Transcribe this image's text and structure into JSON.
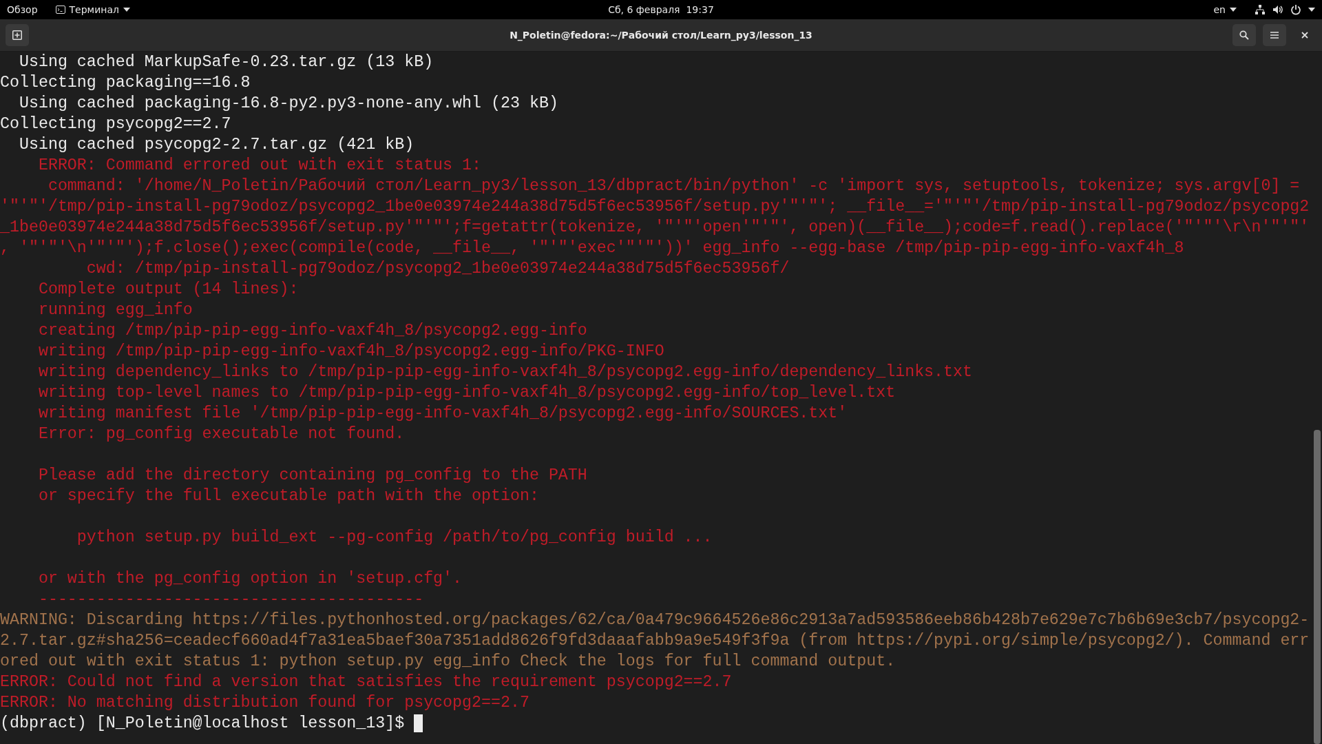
{
  "top_bar": {
    "activities": "Обзор",
    "app_menu": "Терминал",
    "clock": "Сб, 6 февраля  19:37",
    "keyboard_layout": "en"
  },
  "window": {
    "title": "N_Poletin@fedora:~/Рабочий стол/Learn_py3/lesson_13"
  },
  "terminal": {
    "lines": [
      {
        "kind": "normal",
        "text": "  Using cached MarkupSafe-0.23.tar.gz (13 kB)"
      },
      {
        "kind": "normal",
        "text": "Collecting packaging==16.8"
      },
      {
        "kind": "normal",
        "text": "  Using cached packaging-16.8-py2.py3-none-any.whl (23 kB)"
      },
      {
        "kind": "normal",
        "text": "Collecting psycopg2==2.7"
      },
      {
        "kind": "normal",
        "text": "  Using cached psycopg2-2.7.tar.gz (421 kB)"
      },
      {
        "kind": "error",
        "text": "    ERROR: Command errored out with exit status 1:"
      },
      {
        "kind": "error",
        "text": "     command: '/home/N_Poletin/Рабочий стол/Learn_py3/lesson_13/dbpract/bin/python' -c 'import sys, setuptools, tokenize; sys.argv[0] ="
      },
      {
        "kind": "error",
        "text": "'\"'\"'/tmp/pip-install-pg79odoz/psycopg2_1be0e03974e244a38d75d5f6ec53956f/setup.py'\"'\"'; __file__='\"'\"'/tmp/pip-install-pg79odoz/psycopg2"
      },
      {
        "kind": "error",
        "text": "_1be0e03974e244a38d75d5f6ec53956f/setup.py'\"'\"';f=getattr(tokenize, '\"'\"'open'\"'\"', open)(__file__);code=f.read().replace('\"'\"'\\r\\n'\"'\"'"
      },
      {
        "kind": "error",
        "text": ", '\"'\"'\\n'\"'\"');f.close();exec(compile(code, __file__, '\"'\"'exec'\"'\"'))' egg_info --egg-base /tmp/pip-pip-egg-info-vaxf4h_8"
      },
      {
        "kind": "error",
        "text": "         cwd: /tmp/pip-install-pg79odoz/psycopg2_1be0e03974e244a38d75d5f6ec53956f/"
      },
      {
        "kind": "error",
        "text": "    Complete output (14 lines):"
      },
      {
        "kind": "error",
        "text": "    running egg_info"
      },
      {
        "kind": "error",
        "text": "    creating /tmp/pip-pip-egg-info-vaxf4h_8/psycopg2.egg-info"
      },
      {
        "kind": "error",
        "text": "    writing /tmp/pip-pip-egg-info-vaxf4h_8/psycopg2.egg-info/PKG-INFO"
      },
      {
        "kind": "error",
        "text": "    writing dependency_links to /tmp/pip-pip-egg-info-vaxf4h_8/psycopg2.egg-info/dependency_links.txt"
      },
      {
        "kind": "error",
        "text": "    writing top-level names to /tmp/pip-pip-egg-info-vaxf4h_8/psycopg2.egg-info/top_level.txt"
      },
      {
        "kind": "error",
        "text": "    writing manifest file '/tmp/pip-pip-egg-info-vaxf4h_8/psycopg2.egg-info/SOURCES.txt'"
      },
      {
        "kind": "error",
        "text": "    Error: pg_config executable not found."
      },
      {
        "kind": "blank"
      },
      {
        "kind": "error",
        "text": "    Please add the directory containing pg_config to the PATH"
      },
      {
        "kind": "error",
        "text": "    or specify the full executable path with the option:"
      },
      {
        "kind": "blank"
      },
      {
        "kind": "error",
        "text": "        python setup.py build_ext --pg-config /path/to/pg_config build ..."
      },
      {
        "kind": "blank"
      },
      {
        "kind": "error",
        "text": "    or with the pg_config option in 'setup.cfg'."
      },
      {
        "kind": "error",
        "text": "    ----------------------------------------"
      },
      {
        "kind": "warning",
        "text": "WARNING: Discarding https://files.pythonhosted.org/packages/62/ca/0a479c9664526e86c2913a7ad593586eeb86b428b7e629e7c7b6b69e3cb7/psycopg2-"
      },
      {
        "kind": "warning",
        "text": "2.7.tar.gz#sha256=ceadecf660ad4f7a31ea5baef30a7351add8626f9fd3daaafabb9a9e549f3f9a (from https://pypi.org/simple/psycopg2/). Command err"
      },
      {
        "kind": "warning",
        "text": "ored out with exit status 1: python setup.py egg_info Check the logs for full command output."
      },
      {
        "kind": "error",
        "text": "ERROR: Could not find a version that satisfies the requirement psycopg2==2.7"
      },
      {
        "kind": "error",
        "text": "ERROR: No matching distribution found for psycopg2==2.7"
      },
      {
        "kind": "prompt",
        "text": "(dbpract) [N_Poletin@localhost lesson_13]$ "
      }
    ]
  }
}
